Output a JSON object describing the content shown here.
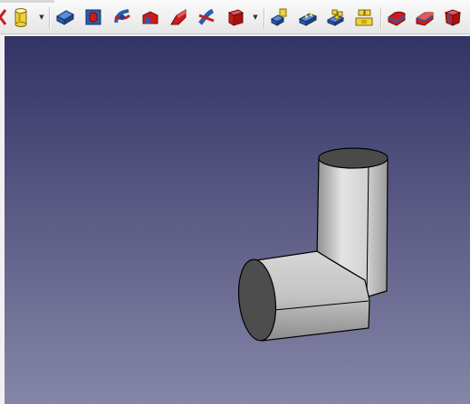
{
  "toolbar": {
    "buttons": [
      {
        "name": "partial-icon",
        "type": "partial"
      },
      {
        "name": "cylinder-icon",
        "type": "cylinder",
        "dropdown": true
      },
      {
        "name": "pad-icon",
        "type": "pad"
      },
      {
        "name": "pocket-icon",
        "type": "pocket"
      },
      {
        "name": "revolution-icon",
        "type": "revolution"
      },
      {
        "name": "groove-icon",
        "type": "groove"
      },
      {
        "name": "additive-loft-icon",
        "type": "loft"
      },
      {
        "name": "additive-pipe-icon",
        "type": "pipe"
      },
      {
        "name": "subtractive-box-icon",
        "type": "subbox",
        "dropdown": true
      },
      {
        "name": "mirrored-icon",
        "type": "mirror"
      },
      {
        "name": "linear-pattern-icon",
        "type": "linear"
      },
      {
        "name": "polar-pattern-icon",
        "type": "polar"
      },
      {
        "name": "multi-transform-icon",
        "type": "multi"
      },
      {
        "name": "fillet-icon",
        "type": "fillet"
      },
      {
        "name": "chamfer-icon",
        "type": "chamfer"
      },
      {
        "name": "draft-icon",
        "type": "draft"
      }
    ]
  },
  "viewport": {
    "background_top": "#333366",
    "background_bottom": "#8686a8",
    "model": "elbow-pipe"
  },
  "colors": {
    "icon_blue": "#2a5db0",
    "icon_red": "#cc1b1b",
    "icon_yellow": "#f2d23a"
  }
}
